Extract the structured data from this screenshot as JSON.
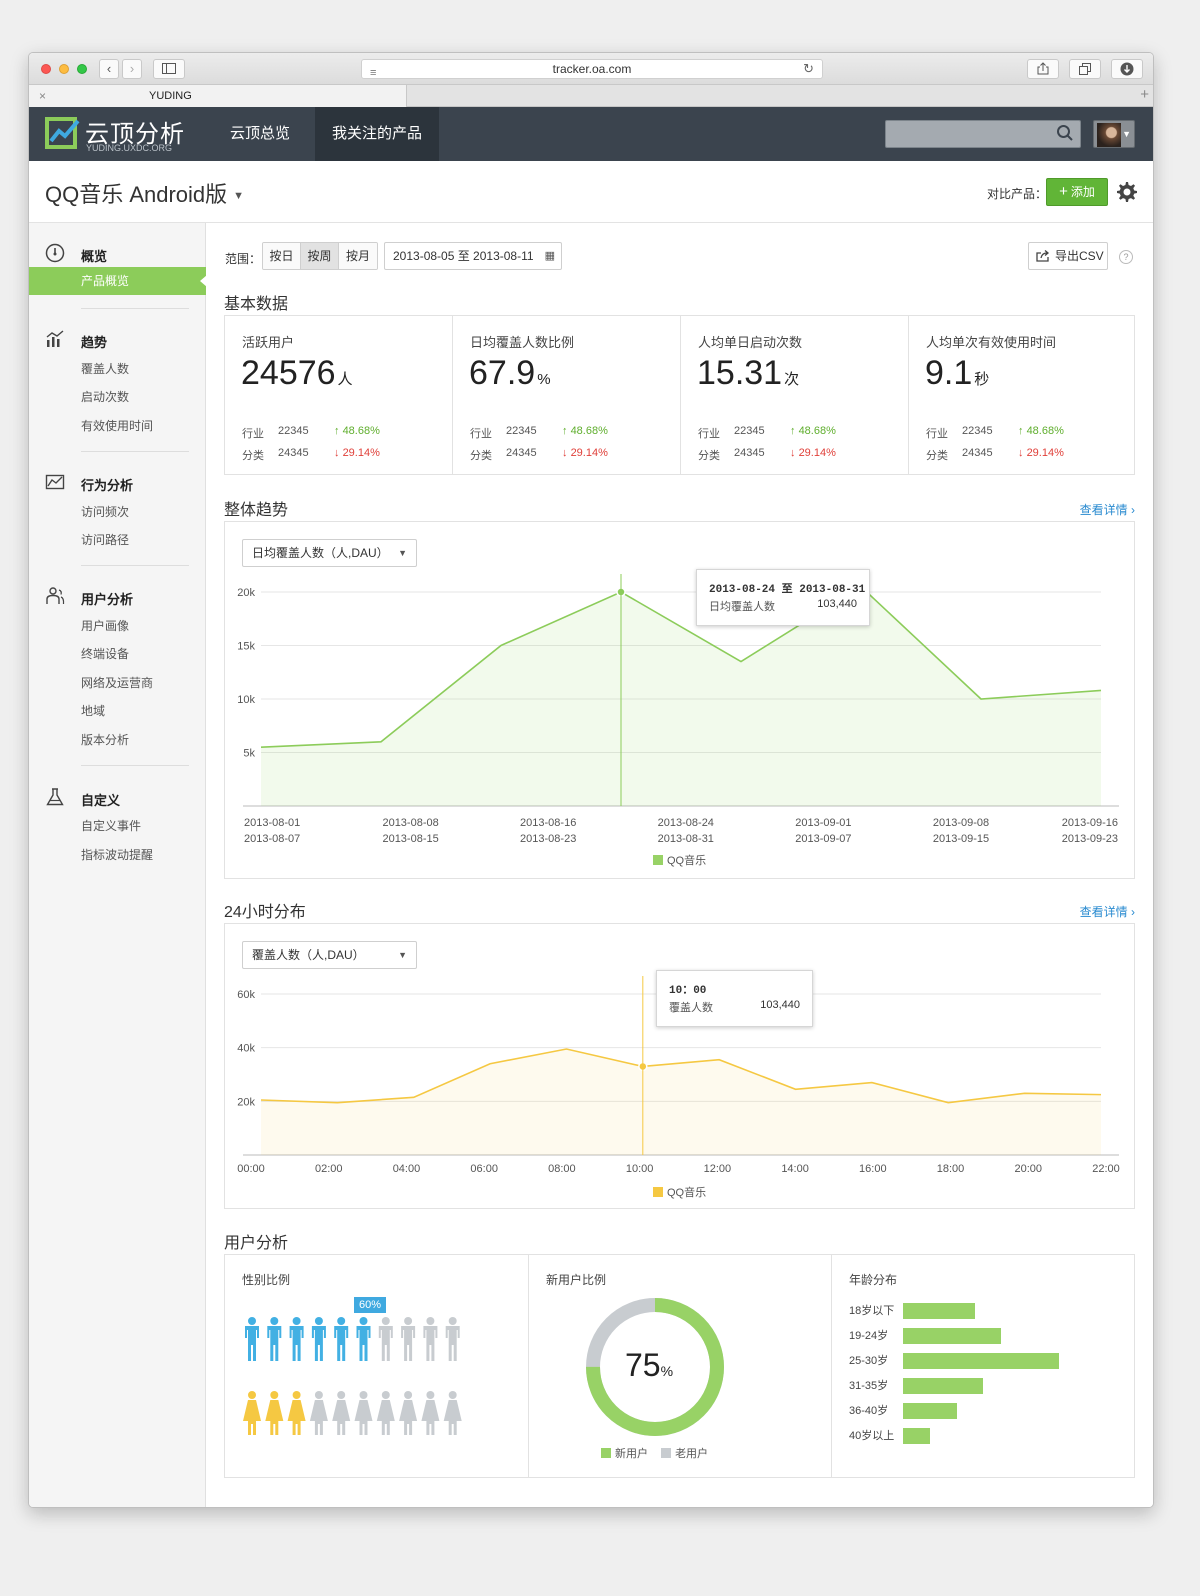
{
  "browser": {
    "url": "tracker.oa.com",
    "tab_title": "YUDING",
    "tab_close": "×",
    "new_tab": "+"
  },
  "app": {
    "logo_text": "云顶分析",
    "logo_sub": "YUDING.UXDC.ORG",
    "nav": [
      "云顶总览",
      "我关注的产品"
    ],
    "active_nav": 1,
    "search_placeholder": ""
  },
  "product": {
    "title": "QQ音乐 Android版",
    "compare_label": "对比产品：",
    "add_label": "添加",
    "add_plus": "+"
  },
  "sidebar": {
    "groups": [
      {
        "title": "概览",
        "icon": "gauge-icon",
        "items": [
          "产品概览"
        ],
        "active": 0
      },
      {
        "title": "趋势",
        "icon": "bar-trend-icon",
        "items": [
          "覆盖人数",
          "启动次数",
          "有效使用时间"
        ]
      },
      {
        "title": "行为分析",
        "icon": "line-chart-icon",
        "items": [
          "访问频次",
          "访问路径"
        ]
      },
      {
        "title": "用户分析",
        "icon": "users-icon",
        "items": [
          "用户画像",
          "终端设备",
          "网络及运营商",
          "地域",
          "版本分析"
        ]
      },
      {
        "title": "自定义",
        "icon": "flask-icon",
        "items": [
          "自定义事件",
          "指标波动提醒"
        ]
      }
    ]
  },
  "filters": {
    "range_label": "范围：",
    "segments": [
      "按日",
      "按周",
      "按月"
    ],
    "selected_segment": 1,
    "date_range": "2013-08-05 至 2013-08-11",
    "export_label": "导出CSV",
    "help": "?"
  },
  "basic": {
    "title": "基本数据",
    "industry_label": "行业",
    "category_label": "分类",
    "stats": [
      {
        "label": "活跃用户",
        "value": "24576",
        "unit": "人",
        "industry": "22345",
        "industry_delta": "48.68%",
        "category": "24345",
        "category_delta": "29.14%"
      },
      {
        "label": "日均覆盖人数比例",
        "value": "67.9",
        "unit": "%",
        "industry": "22345",
        "industry_delta": "48.68%",
        "category": "24345",
        "category_delta": "29.14%"
      },
      {
        "label": "人均单日启动次数",
        "value": "15.31",
        "unit": "次",
        "industry": "22345",
        "industry_delta": "48.68%",
        "category": "24345",
        "category_delta": "29.14%"
      },
      {
        "label": "人均单次有效使用时间",
        "value": "9.1",
        "unit": "秒",
        "industry": "22345",
        "industry_delta": "48.68%",
        "category": "24345",
        "category_delta": "29.14%"
      }
    ],
    "up_arrow": "↑",
    "down_arrow": "↓"
  },
  "trend": {
    "title": "整体趋势",
    "detail_link": "查看详情 ›",
    "select_value": "日均覆盖人数（人,DAU）",
    "tooltip": {
      "header": "2013-08-24 至 2013-08-31",
      "key": "日均覆盖人数",
      "value": "103,440"
    },
    "legend": "QQ音乐"
  },
  "hourly": {
    "title": "24小时分布",
    "detail_link": "查看详情 ›",
    "select_value": "覆盖人数（人,DAU）",
    "tooltip": {
      "header": "10：00",
      "key": "覆盖人数",
      "value": "103,440"
    },
    "legend": "QQ音乐"
  },
  "user_analysis": {
    "title": "用户分析",
    "gender_label": "性别比例",
    "gender_badge": "60%",
    "male_highlighted": 6,
    "female_highlighted": 3,
    "icons_per_row": 10,
    "new_user_label": "新用户比例",
    "new_user_value": "75",
    "new_user_unit": "%",
    "new_user_fraction": 0.75,
    "legend_new": "新用户",
    "legend_old": "老用户",
    "age_label": "年龄分布"
  },
  "colors": {
    "green": "#98d266",
    "green_line": "#8ccc5a",
    "yellow": "#f5c842",
    "blue": "#42b0e3",
    "female": "#f5c842",
    "grey": "#c8ccd0"
  },
  "chart_data": [
    {
      "type": "area",
      "title": "整体趋势",
      "series": [
        {
          "name": "QQ音乐",
          "values": [
            5500,
            6000,
            15000,
            20000,
            13500,
            20500,
            10000,
            10800
          ]
        }
      ],
      "x": [
        "2013-08-01",
        "2013-08-08",
        "2013-08-16",
        "2013-08-24",
        "2013-09-01",
        "2013-09-08",
        "2013-09-16",
        "2013-09-23"
      ],
      "tick_labels_top": [
        "2013-08-01",
        "2013-08-08",
        "2013-08-16",
        "2013-08-24",
        "2013-09-01",
        "2013-09-08",
        "2013-09-16"
      ],
      "tick_labels_bottom": [
        "2013-08-07",
        "2013-08-15",
        "2013-08-23",
        "2013-08-31",
        "2013-09-07",
        "2013-09-15",
        "2013-09-23"
      ],
      "yticks": [
        "5k",
        "10k",
        "15k",
        "20k"
      ],
      "ylim": [
        0,
        20000
      ],
      "grid": true,
      "legend": "bottom-center"
    },
    {
      "type": "area",
      "title": "24小时分布",
      "series": [
        {
          "name": "QQ音乐",
          "values": [
            20500,
            19500,
            21500,
            34000,
            39500,
            33000,
            35500,
            24500,
            27000,
            19500,
            23000,
            22500
          ]
        }
      ],
      "x": [
        "00:00",
        "02:00",
        "04:00",
        "06:00",
        "08:00",
        "10:00",
        "12:00",
        "14:00",
        "16:00",
        "18:00",
        "20:00",
        "22:00"
      ],
      "yticks": [
        "20k",
        "40k",
        "60k"
      ],
      "ylim": [
        0,
        60000
      ],
      "grid": true,
      "legend": "bottom-center"
    },
    {
      "type": "bar",
      "title": "年龄分布",
      "categories": [
        "18岁以下",
        "19-24岁",
        "25-30岁",
        "31-35岁",
        "36-40岁",
        "40岁以上"
      ],
      "values": [
        72,
        98,
        156,
        80,
        54,
        27
      ]
    },
    {
      "type": "pie",
      "title": "新用户比例",
      "categories": [
        "新用户",
        "老用户"
      ],
      "values": [
        75,
        25
      ]
    }
  ]
}
